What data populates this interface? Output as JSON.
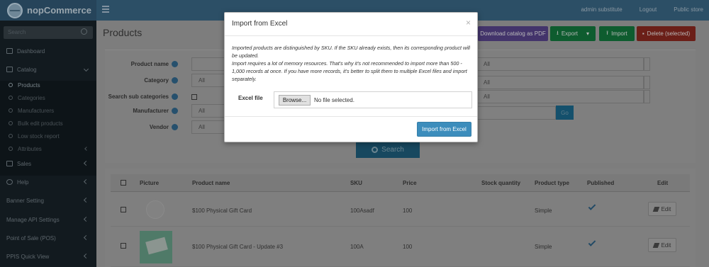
{
  "topbar": {
    "brand": "nopCommerce",
    "user": "admin substitute",
    "logout": "Logout",
    "public_store": "Public store"
  },
  "sidebar": {
    "search_placeholder": "Search",
    "items": [
      {
        "label": "Dashboard"
      },
      {
        "label": "Catalog"
      },
      {
        "label": "Products"
      },
      {
        "label": "Categories"
      },
      {
        "label": "Manufacturers"
      },
      {
        "label": "Bulk edit products"
      },
      {
        "label": "Low stock report"
      },
      {
        "label": "Attributes"
      },
      {
        "label": "Sales"
      },
      {
        "label": "Help"
      },
      {
        "label": "Banner Setting"
      },
      {
        "label": "Manage API Settings"
      },
      {
        "label": "Point of Sale (POS)"
      },
      {
        "label": "PPIS Quick View"
      }
    ]
  },
  "page": {
    "title": "Products",
    "buttons": {
      "download_pdf": "Download catalog as PDF",
      "export": "Export",
      "import": "Import",
      "delete_selected": "Delete (selected)"
    },
    "colors": {
      "pdf": "#43346b",
      "export": "#0e5c2f",
      "import": "#0e5c2f",
      "delete": "#6b1f18"
    }
  },
  "filters": {
    "product_name": "Product name",
    "category": "Category",
    "category_value": "All",
    "search_sub_categories": "Search sub categories",
    "manufacturer": "Manufacturer",
    "manufacturer_value": "All",
    "vendor": "Vendor",
    "vendor_value": "All",
    "right_values": [
      "All",
      "All",
      "All"
    ],
    "go": "Go",
    "search_button": "Search"
  },
  "table": {
    "headers": [
      "Picture",
      "Product name",
      "SKU",
      "Price",
      "Stock quantity",
      "Product type",
      "Published",
      "Edit"
    ],
    "rows": [
      {
        "name": "$100 Physical Gift Card",
        "sku": "100Asadf",
        "price": "100",
        "type": "Simple",
        "edit": "Edit"
      },
      {
        "name": "$100 Physical Gift Card - Update #3",
        "sku": "100A",
        "price": "100",
        "type": "Simple",
        "edit": "Edit"
      }
    ]
  },
  "modal": {
    "title": "Import from Excel",
    "close": "×",
    "note_1": "Imported products are distinguished by SKU. If the SKU already exists, then its corresponding product will be updated.",
    "note_2": "Import requires a lot of memory resources. That's why it's not recommended to import more than 500 - 1,000 records at once. If you have more records, it's better to split them to multiple Excel files and import separately.",
    "excel_label": "Excel file",
    "browse": "Browse...",
    "no_file": "No file selected.",
    "submit": "Import from Excel"
  }
}
